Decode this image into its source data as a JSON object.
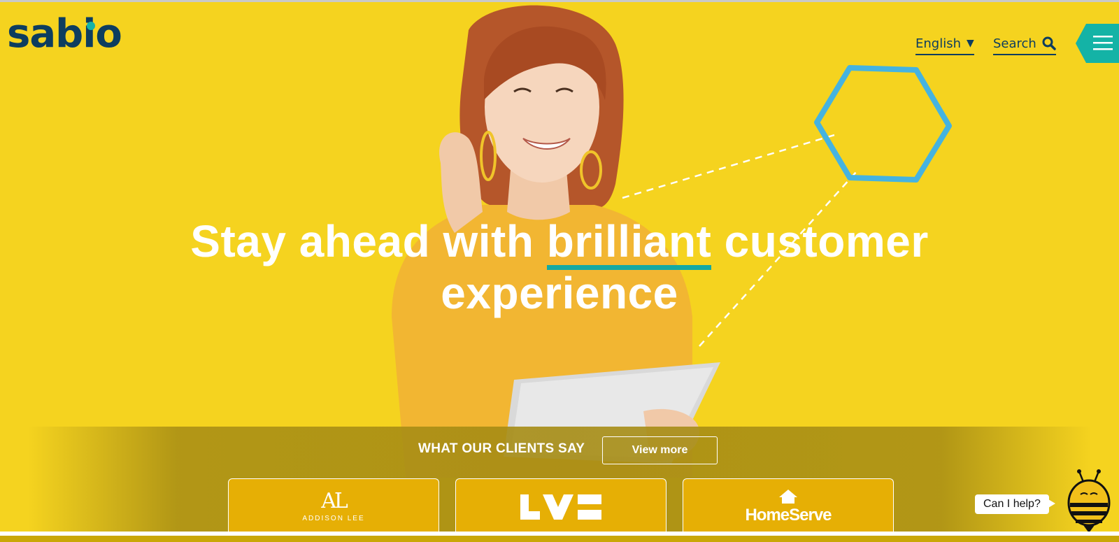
{
  "brand": {
    "logo_text": "sabio",
    "accent": "#14b3a6",
    "primary": "#0d3d5f",
    "background": "#f5d31f"
  },
  "header": {
    "language_label": "English",
    "search_label": "Search",
    "menu_icon": "hamburger-icon"
  },
  "hero": {
    "headline_part1": "Stay ahead with",
    "headline_highlight": "brilliant",
    "headline_part2": "customer",
    "headline_line2": "experience"
  },
  "clients": {
    "title": "WHAT OUR CLIENTS SAY",
    "view_more_label": "View more",
    "logos": [
      {
        "mark": "AL",
        "name": "ADDISON LEE"
      },
      {
        "name": "LV="
      },
      {
        "name": "HomeServe"
      }
    ]
  },
  "chat": {
    "prompt": "Can I help?",
    "icon": "bee-mascot-icon"
  }
}
